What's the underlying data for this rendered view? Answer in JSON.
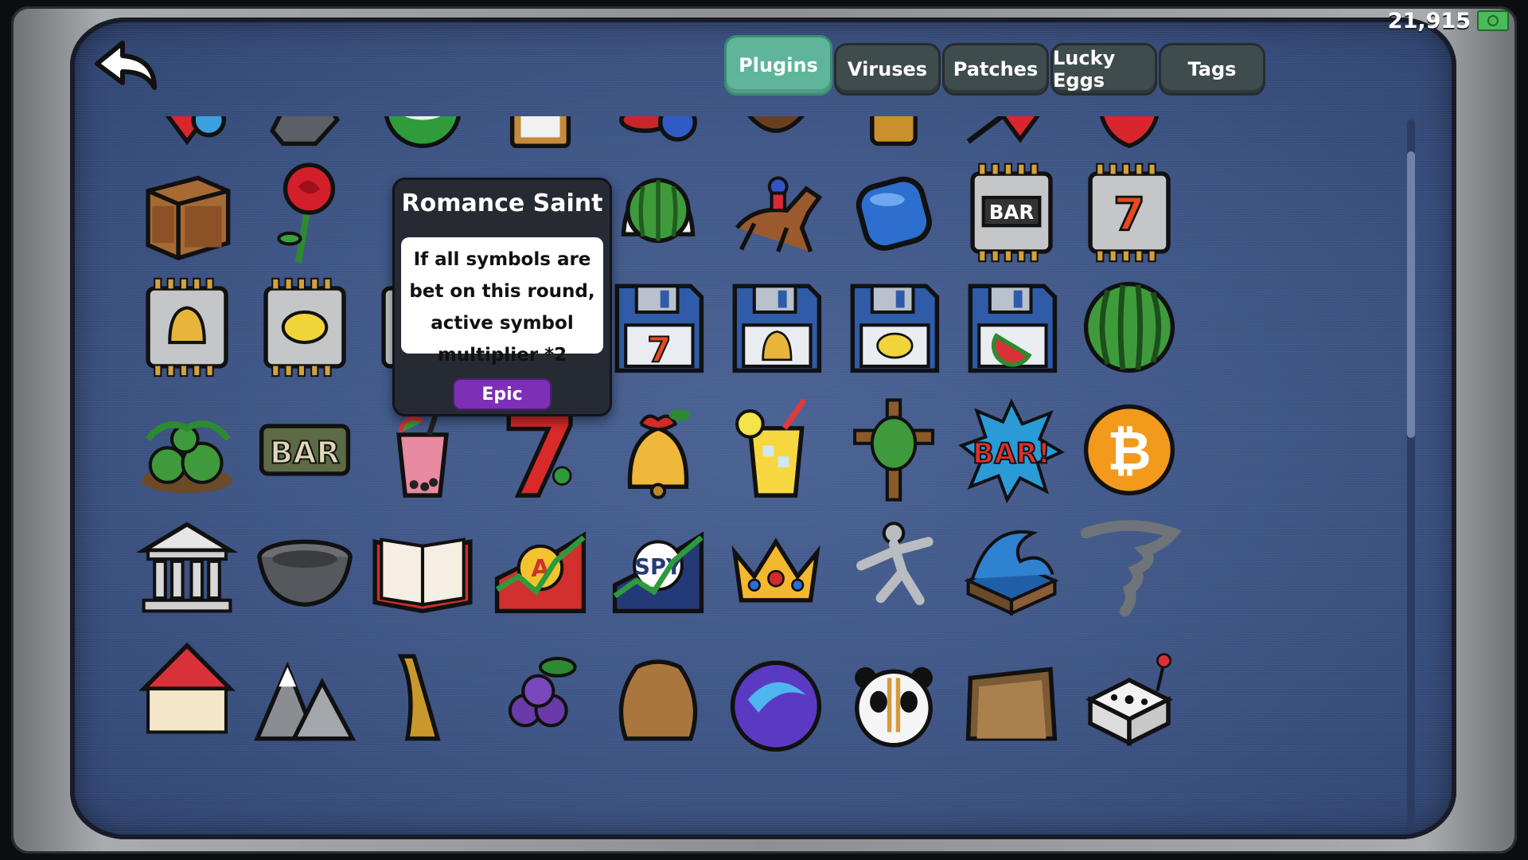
{
  "tabs": [
    {
      "label": "Plugins",
      "active": true
    },
    {
      "label": "Viruses",
      "active": false
    },
    {
      "label": "Patches",
      "active": false
    },
    {
      "label": "Lucky Eggs",
      "active": false
    },
    {
      "label": "Tags",
      "active": false
    }
  ],
  "currency": {
    "amount": "21,915",
    "icon": "cash-icon"
  },
  "tooltip": {
    "title": "Romance Saint",
    "description": "If all symbols are bet on this round, active symbol multiplier *2",
    "rarity": "Epic",
    "rarity_color": "#7d2fb8"
  },
  "grid": {
    "rows": [
      [
        "heart-drop-icon",
        "rock-icon",
        "green-orb-icon",
        "clipboard-icon",
        "poker-chips-icon",
        "wooden-bowl-icon",
        "jar-icon",
        "heart-arrow-icon",
        "apple-icon"
      ],
      [
        "wooden-crate-icon",
        "rose-icon",
        "ghost-icon",
        "watermelon-doctor-icon",
        "racehorse-jockey-icon",
        "blue-gem-icon",
        "bar-chip-icon",
        "seven-chip-icon"
      ],
      [
        "bell-chip-icon",
        "lemon-chip-icon",
        "hidden-chip-icon",
        "bar-floppy-icon",
        "seven-floppy-icon",
        "bell-floppy-icon",
        "lemon-floppy-icon",
        "watermelon-floppy-icon",
        "watermelon-icon"
      ],
      [
        "watermelon-vine-icon",
        "bar-sign-icon",
        "bubble-tea-icon",
        "lucky-seven-icon",
        "christmas-bell-icon",
        "lemonade-icon",
        "watermelon-cross-icon",
        "bar-burst-icon",
        "bitcoin-icon"
      ],
      [
        "bank-icon",
        "metal-bowl-icon",
        "open-book-icon",
        "stock-a-chart-icon",
        "spy-chart-icon",
        "crown-icon",
        "falling-stickman-icon",
        "wave-block-icon",
        "tornado-icon"
      ],
      [
        "carousel-icon",
        "mountains-icon",
        "genie-lamp-icon",
        "grapes-icon",
        "money-bag-icon",
        "galaxy-orb-icon",
        "panda-icon",
        "frame-icon",
        "dice-icon"
      ]
    ]
  }
}
